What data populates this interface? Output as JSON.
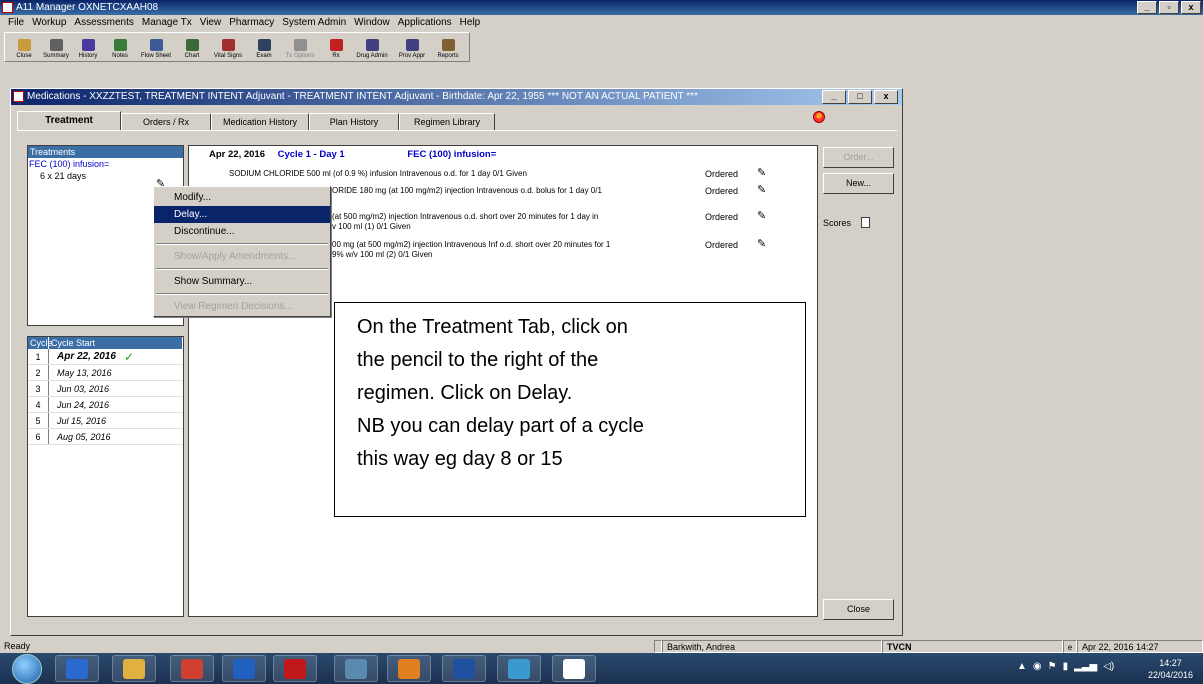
{
  "app": {
    "title": "A11 Manager OXNETCXAAH08",
    "controls": [
      "_",
      "▫",
      "x"
    ]
  },
  "menubar": [
    "File",
    "Workup",
    "Assessments",
    "Manage Tx",
    "View",
    "Pharmacy",
    "System Admin",
    "Window",
    "Applications",
    "Help"
  ],
  "toolbar": [
    {
      "label": "Close",
      "icon": "folder-icon",
      "color": "#c89b3c"
    },
    {
      "label": "Summary",
      "icon": "flag-icon",
      "color": "#606060"
    },
    {
      "label": "History",
      "icon": "hx-icon",
      "color": "#4a3aa0"
    },
    {
      "label": "Notes",
      "icon": "notes-icon",
      "color": "#3a7a3a"
    },
    {
      "label": "Flow Sheet",
      "icon": "flowsheet-icon",
      "color": "#3a5a9a"
    },
    {
      "label": "Chart",
      "icon": "chart-icon",
      "color": "#3a6a3a"
    },
    {
      "label": "Vital Signs",
      "icon": "vitals-icon",
      "color": "#a03030"
    },
    {
      "label": "Exam",
      "icon": "exam-icon",
      "color": "#304060"
    },
    {
      "label": "Tx Options",
      "icon": "tx-options-icon",
      "color": "#909090",
      "disabled": true
    },
    {
      "label": "Rx",
      "icon": "rx-icon",
      "color": "#c02020"
    },
    {
      "label": "Drug Admin",
      "icon": "drug-admin-icon",
      "color": "#404080"
    },
    {
      "label": "Prov Appr",
      "icon": "prov-appr-icon",
      "color": "#404080"
    },
    {
      "label": "Reports",
      "icon": "reports-icon",
      "color": "#806030"
    }
  ],
  "medwin": {
    "title": "Medications - XXZZTEST, TREATMENT INTENT Adjuvant  - TREATMENT INTENT Adjuvant - Birthdate: Apr 22, 1955 *** NOT AN ACTUAL PATIENT ***",
    "tabs": [
      "Treatment",
      "Orders / Rx",
      "Medication History",
      "Plan History",
      "Regimen Library"
    ],
    "alert_icon": "⊘"
  },
  "treatments": {
    "header": "Treatments",
    "name": "FEC (100) infusion=",
    "duration": "6 x 21 days"
  },
  "cycles": {
    "headers": [
      "Cycle",
      "Cycle Start"
    ],
    "rows": [
      {
        "num": "1",
        "date": "Apr 22, 2016",
        "done": "✓"
      },
      {
        "num": "2",
        "date": "May 13, 2016"
      },
      {
        "num": "3",
        "date": "Jun 03, 2016"
      },
      {
        "num": "4",
        "date": "Jun 24, 2016"
      },
      {
        "num": "5",
        "date": "Jul 15, 2016"
      },
      {
        "num": "6",
        "date": "Aug 05, 2016"
      }
    ]
  },
  "detail": {
    "date": "Apr 22, 2016",
    "cycle": "Cycle 1 - Day 1",
    "regimen": "FEC (100) infusion=",
    "orders": [
      {
        "lines": [
          "SODIUM CHLORIDE 500 ml (of 0.9 %) infusion Intravenous o.d. for 1 day   0/1 Given"
        ],
        "status": "Ordered"
      },
      {
        "lines": [
          "ORIDE 180 mg (at 100 mg/m2) injection Intravenous o.d. bolus for 1 day   0/1"
        ],
        "status": "Ordered"
      },
      {
        "lines": [
          "(at 500 mg/m2) injection Intravenous o.d. short over 20 minutes for 1 day in",
          "v 100 ml (1)   0/1 Given"
        ],
        "status": "Ordered"
      },
      {
        "lines": [
          "00 mg (at 500 mg/m2) injection Intravenous Inf o.d. short over 20 minutes for 1",
          "9% w/v 100 ml (2)   0/1 Given"
        ],
        "status": "Ordered"
      }
    ]
  },
  "side_buttons": {
    "order": "Order...",
    "new": "New...",
    "scores": "Scores",
    "close": "Close"
  },
  "context_menu": [
    {
      "label": "Modify...",
      "state": "normal"
    },
    {
      "label": "Delay...",
      "state": "selected"
    },
    {
      "label": "Discontinue...",
      "state": "normal"
    },
    {
      "sep": true
    },
    {
      "label": "Show/Apply Amendments...",
      "state": "disabled"
    },
    {
      "sep": true
    },
    {
      "label": "Show Summary...",
      "state": "normal"
    },
    {
      "sep": true
    },
    {
      "label": "View Regimen Decisions...",
      "state": "disabled"
    }
  ],
  "callout": {
    "lines": [
      "On the Treatment Tab, click on",
      "the pencil to the right of the",
      "regimen. Click on Delay.",
      "NB you can delay part of a cycle",
      "this way eg day 8 or 15"
    ]
  },
  "statusbar": {
    "ready": "Ready",
    "user": "Barkwith, Andrea",
    "site": "TVCN",
    "indicator": "e",
    "datetime": "Apr 22, 2016 14:27"
  },
  "taskbar": {
    "apps": [
      {
        "name": "ie-icon",
        "color": "#2a6ad0"
      },
      {
        "name": "explorer-icon",
        "color": "#e0b040"
      },
      {
        "name": "chrome-icon",
        "color": "#d04030"
      },
      {
        "name": "outlook-icon",
        "color": "#2060c0"
      },
      {
        "name": "acrobat-icon",
        "color": "#c01818"
      },
      {
        "name": "app-icon",
        "color": "#5a8ab0"
      },
      {
        "name": "powerpoint-icon",
        "color": "#e08020"
      },
      {
        "name": "word-icon",
        "color": "#2050a0"
      },
      {
        "name": "medical-icon",
        "color": "#3a9ad0"
      },
      {
        "name": "chart-app-icon",
        "color": "#ffffff"
      }
    ],
    "time": "14:27",
    "date": "22/04/2016"
  }
}
